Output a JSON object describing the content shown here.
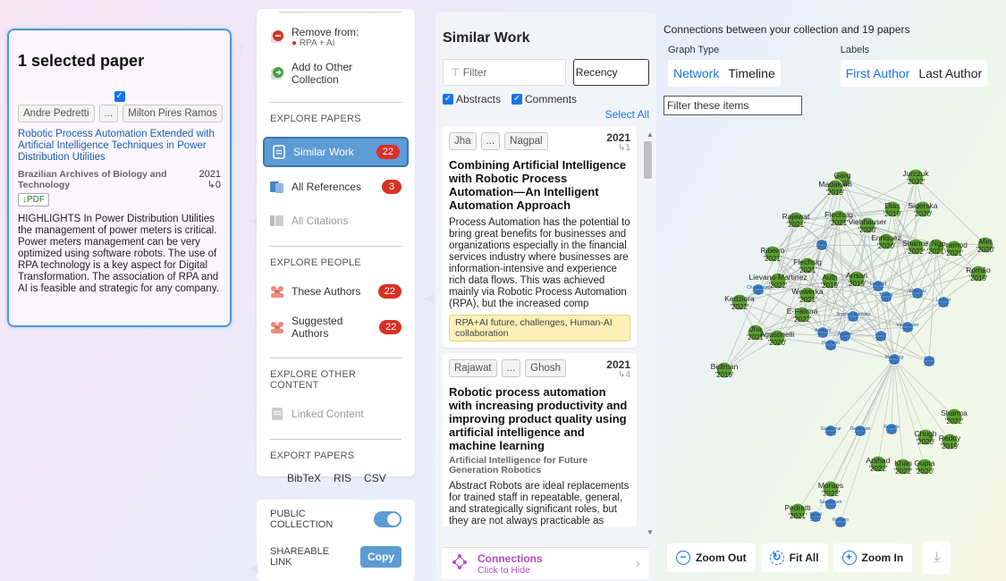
{
  "selected": {
    "title": "1 selected paper",
    "authors": [
      "Andre Pedretti",
      "...",
      "Milton Pires Ramos"
    ],
    "paper_title": "Robotic Process Automation Extended with Artificial Intelligence Techniques in Power Distribution Utilities",
    "journal": "Brazilian Archives of Biology and Technology",
    "year": "2021",
    "cites": "↳0",
    "pdf": "↓PDF",
    "abstract": "HIGHLIGHTS In Power Distribution Utilities the management of power meters is critical. Power meters management can be very optimized using software robots. The use of RPA technology is a key aspect for Digital Transformation. The association of RPA and AI is feasible and strategic for any company."
  },
  "nav": {
    "remove_label": "Remove from:",
    "remove_sub": "RPA + AI",
    "add_label": "Add to Other Collection",
    "explore_papers": "EXPLORE PAPERS",
    "similar_work": "Similar Work",
    "similar_count": "22",
    "all_references": "All References",
    "references_count": "3",
    "all_citations": "All Citations",
    "explore_people": "EXPLORE PEOPLE",
    "these_authors": "These Authors",
    "these_authors_count": "22",
    "suggested_authors": "Suggested Authors",
    "suggested_count": "22",
    "explore_other": "EXPLORE OTHER CONTENT",
    "linked_content": "Linked Content",
    "export_papers": "EXPORT PAPERS",
    "export_formats": [
      "BibTeX",
      "RIS",
      "CSV"
    ],
    "public_collection": "PUBLIC COLLECTION",
    "shareable_link": "SHAREABLE LINK",
    "copy": "Copy"
  },
  "similar": {
    "header": "Similar Work",
    "filter_placeholder": "Filter",
    "sort": "Recency",
    "abstracts": "Abstracts",
    "comments": "Comments",
    "select_all": "Select All",
    "cards": [
      {
        "authors": [
          "Jha",
          "...",
          "Nagpal"
        ],
        "year": "2021",
        "cites": "↳1",
        "title": "Combining Artificial Intelligence with Robotic Process Automation—An Intelligent Automation Approach",
        "journal": "",
        "abstract": "Process Automation has the potential to bring great benefits for businesses and organizations especially in the financial services industry where businesses are information-intensive and experience rich data flows. This was achieved mainly via Robotic Process Automation (RPA), but the increased comp",
        "tag": "RPA+AI future, challenges, Human-AI collaboration"
      },
      {
        "authors": [
          "Rajawat",
          "...",
          "Ghosh"
        ],
        "year": "2021",
        "cites": "↳4",
        "title": "Robotic process automation with increasing productivity and improving product quality using artificial intelligence and machine learning",
        "journal": "Artificial Intelligence for Future Generation Robotics",
        "abstract": "Abstract Robots are ideal replacements for trained staff in repeatable, general, and strategically significant roles, but they are not always practicable as replacements. In spite of growth and advancement in the",
        "tag": ""
      }
    ],
    "connections_label": "Connections",
    "connections_sub": "Click to Hide"
  },
  "graph": {
    "header": "Connections between your collection and 19 papers",
    "graph_type_label": "Graph Type",
    "graph_types": [
      "Network",
      "Timeline"
    ],
    "labels_label": "Labels",
    "labels_opts": [
      "First Author",
      "Last Author"
    ],
    "filter_placeholder": "Filter these items",
    "zoom_out": "Zoom Out",
    "fit_all": "Fit All",
    "zoom_in": "Zoom In",
    "colors": {
      "green": "#5a9e2f",
      "blue": "#4a86c8",
      "accent": "#1a73e8"
    },
    "green_nodes": [
      {
        "name": "Garg",
        "year": "2022"
      },
      {
        "name": "Jurczuk",
        "year": "2022"
      },
      {
        "name": "Madakam",
        "year": "2019"
      },
      {
        "name": "Dias",
        "year": "2019"
      },
      {
        "name": "Siderska",
        "year": "2020"
      },
      {
        "name": "Rajawat",
        "year": "2021"
      },
      {
        "name": "Flechsig",
        "year": "2021"
      },
      {
        "name": "Viehhauser",
        "year": "2020"
      },
      {
        "name": "Enriquez",
        "year": "2020"
      },
      {
        "name": "Sharma",
        "year": "2022"
      },
      {
        "name": "Ng",
        "year": "2021"
      },
      {
        "name": "Pramod",
        "year": "2021"
      },
      {
        "name": "Met",
        "year": "2020"
      },
      {
        "name": "Ribeiro",
        "year": "2021"
      },
      {
        "name": "Flechsig",
        "year": "2021"
      },
      {
        "name": "Romão",
        "year": "2019"
      },
      {
        "name": "Lievano-Martinez",
        "year": "2022"
      },
      {
        "name": "Auth",
        "year": "2019"
      },
      {
        "name": "Ansari",
        "year": "2019"
      },
      {
        "name": "Wewerka",
        "year": "2021"
      },
      {
        "name": "Kedziora",
        "year": "2022"
      },
      {
        "name": "E-Fatima",
        "year": "2022"
      },
      {
        "name": "Jha",
        "year": "2021"
      },
      {
        "name": "Agostinelli",
        "year": "2020"
      },
      {
        "name": "Bellman",
        "year": "2019"
      },
      {
        "name": "Sharma",
        "year": "2022"
      },
      {
        "name": "Chugh",
        "year": "2020"
      },
      {
        "name": "Reddy",
        "year": "2019"
      },
      {
        "name": "Arshad",
        "year": "2022"
      },
      {
        "name": "Khan",
        "year": "2022"
      },
      {
        "name": "Gupta",
        "year": "2020"
      },
      {
        "name": "Moraes",
        "year": "2022"
      },
      {
        "name": "Pedretti",
        "year": "2021"
      }
    ],
    "blue_nodes": [
      {
        "name": "Aalst",
        "year": "2018"
      },
      {
        "name": "Chakraborti",
        "year": "2020"
      },
      {
        "name": "Leopold",
        "year": "2018"
      },
      {
        "name": "Huang",
        "year": "2019"
      },
      {
        "name": "Wilkinski",
        "year": "2019"
      },
      {
        "name": "Leshob",
        "year": "2018"
      },
      {
        "name": "Jimenez-Ramirez",
        "year": "2019"
      },
      {
        "name": "Viehhauser",
        "year": "2020"
      },
      {
        "name": "Asatiani",
        "year": "2018"
      },
      {
        "name": "Aguirre",
        "year": "2017"
      },
      {
        "name": "Lacity",
        "year": "2016"
      },
      {
        "name": "Hofmann",
        "year": "2020"
      },
      {
        "name": "Mendling",
        "year": "2018"
      },
      {
        "name": "Syed",
        "year": "2020"
      },
      {
        "name": "Sivakumar",
        "year": "2019"
      },
      {
        "name": "Devarajan",
        "year": "2020"
      },
      {
        "name": "Rozario",
        "year": "2020"
      },
      {
        "name": "Bassil",
        "year": "2021"
      },
      {
        "name": "Saukkonen",
        "year": "2019"
      },
      {
        "name": "Romero",
        "year": "2019"
      }
    ]
  }
}
